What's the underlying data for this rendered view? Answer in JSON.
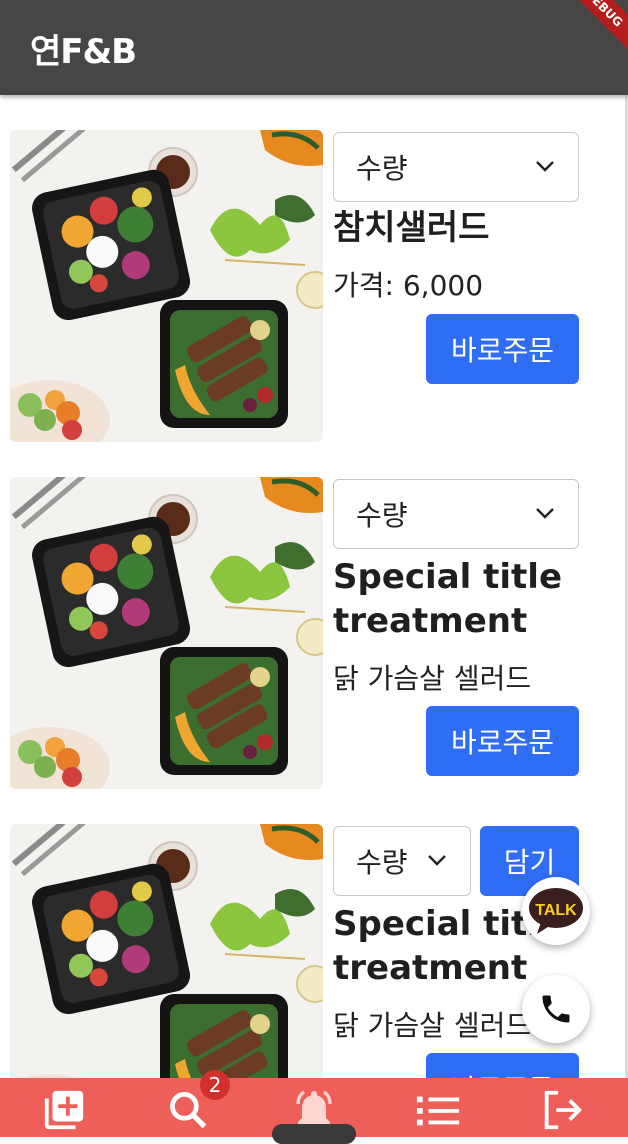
{
  "app": {
    "title": "연F&B",
    "debug_label": "DEBUG"
  },
  "products": [
    {
      "qty_label": "수량",
      "name_lines": [
        "참치샐러드"
      ],
      "subtitle": "가격: 6,000",
      "order_label": "바로주문",
      "cart_label": null
    },
    {
      "qty_label": "수량",
      "name_lines": [
        "Special title",
        "treatment"
      ],
      "subtitle": "닭 가슴살 셀러드",
      "order_label": "바로주문",
      "cart_label": null
    },
    {
      "qty_label": "수량",
      "name_lines": [
        "Special title",
        "treatment"
      ],
      "subtitle": "닭 가슴살 셀러드",
      "order_label": "바로주문",
      "cart_label": "담기"
    }
  ],
  "fabs": {
    "talk_label": "TALK",
    "call_icon": "phone-icon"
  },
  "bottom_nav": {
    "items": [
      {
        "icon": "add-box-icon"
      },
      {
        "icon": "search-icon",
        "badge": "2"
      },
      {
        "icon": "bell-icon"
      },
      {
        "icon": "list-icon"
      },
      {
        "icon": "logout-icon"
      }
    ]
  },
  "colors": {
    "appbar": "#464646",
    "accent": "#2f6df6",
    "bottom_nav": "#ef5f5a",
    "badge": "#d32f2f"
  }
}
